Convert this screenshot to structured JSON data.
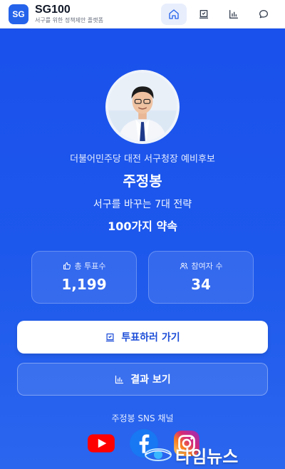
{
  "header": {
    "logo": "SG",
    "title": "SG100",
    "subtitle": "서구를 위한 정책제안 플랫폼",
    "nav": [
      {
        "icon": "home-icon",
        "active": true
      },
      {
        "icon": "vote-icon",
        "active": false
      },
      {
        "icon": "chart-icon",
        "active": false
      },
      {
        "icon": "chat-icon",
        "active": false
      }
    ]
  },
  "hero": {
    "subtitle": "더불어민주당 대전 서구청장 예비후보",
    "name": "주정봉",
    "tagline": "서구를 바꾸는 7대 전략",
    "promise": "100가지 약속"
  },
  "stats": {
    "votes_label": "총 투표수",
    "votes_value": "1,199",
    "participants_label": "참여자 수",
    "participants_value": "34"
  },
  "actions": {
    "vote_label": "투표하러 가기",
    "results_label": "결과 보기"
  },
  "sns": {
    "title": "주정봉 SNS 채널",
    "channels": [
      "youtube-icon",
      "facebook-icon",
      "instagram-icon"
    ]
  },
  "watermark": {
    "text": "타임뉴스"
  },
  "colors": {
    "brand": "#2563eb",
    "hero_bg": "#1a50ec",
    "button_text": "#1d4ed8"
  }
}
